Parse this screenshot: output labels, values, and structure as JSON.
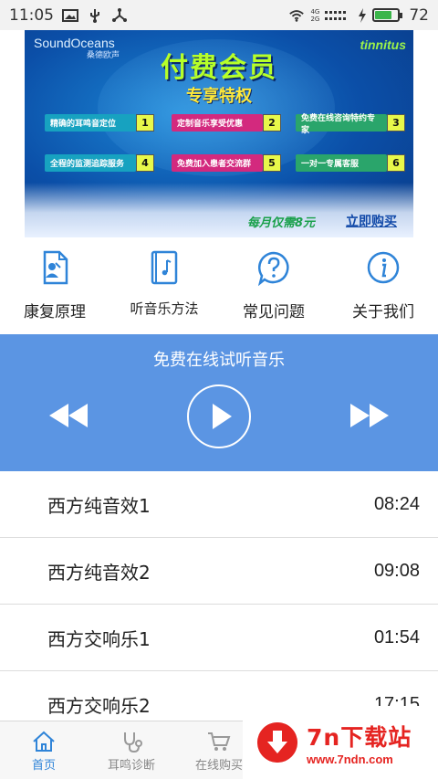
{
  "status_bar": {
    "time": "11:05",
    "net_top": "4G",
    "net_bottom": "2G",
    "battery_level": "72",
    "battery_fill": 0.72,
    "icons": [
      "image-icon",
      "usb-icon",
      "share-icon",
      "wifi-icon",
      "signal-icon",
      "charging-icon",
      "battery-icon"
    ]
  },
  "banner": {
    "brand_left": "SoundOceans",
    "brand_left_sub": "桑德欧声",
    "brand_right": "tinnitus",
    "title": "付费会员",
    "subtitle": "专享特权",
    "features": [
      {
        "label": "精确的耳鸣音定位",
        "num": "1",
        "color": "#17a2c0"
      },
      {
        "label": "定制音乐享受优惠",
        "num": "2",
        "color": "#d3297e"
      },
      {
        "label": "免费在线咨询特约专家",
        "num": "3",
        "color": "#2aa56b"
      },
      {
        "label": "全程的监测追踪服务",
        "num": "4",
        "color": "#17a2c0"
      },
      {
        "label": "免费加入患者交流群",
        "num": "5",
        "color": "#d3297e"
      },
      {
        "label": "一对一专属客服",
        "num": "6",
        "color": "#2aa56b"
      }
    ],
    "price": "每月仅需8元",
    "buy": "立即购买"
  },
  "shortcuts": [
    {
      "label": "康复原理",
      "icon": "document-icon"
    },
    {
      "label": "听音乐方法",
      "icon": "music-book-icon"
    },
    {
      "label": "常见问题",
      "icon": "question-icon"
    },
    {
      "label": "关于我们",
      "icon": "info-icon"
    }
  ],
  "player": {
    "title": "免费在线试听音乐",
    "icons": [
      "rewind-icon",
      "play-icon",
      "fast-forward-icon"
    ]
  },
  "tracks": [
    {
      "name": "西方纯音效1",
      "duration": "08:24"
    },
    {
      "name": "西方纯音效2",
      "duration": "09:08"
    },
    {
      "name": "西方交响乐1",
      "duration": "01:54"
    },
    {
      "name": "西方交响乐2",
      "duration": "17:15"
    }
  ],
  "bottom_nav": [
    {
      "label": "首页",
      "icon": "home-icon",
      "active": true
    },
    {
      "label": "耳鸣诊断",
      "icon": "stethoscope-icon",
      "active": false
    },
    {
      "label": "在线购买",
      "icon": "cart-icon",
      "active": false
    }
  ],
  "watermark": {
    "title": "7n下载站",
    "url": "www.7ndn.com"
  },
  "colors": {
    "accent": "#5b95e3",
    "tab_active": "#2f84d8",
    "icon_blue": "#2f84d8"
  }
}
